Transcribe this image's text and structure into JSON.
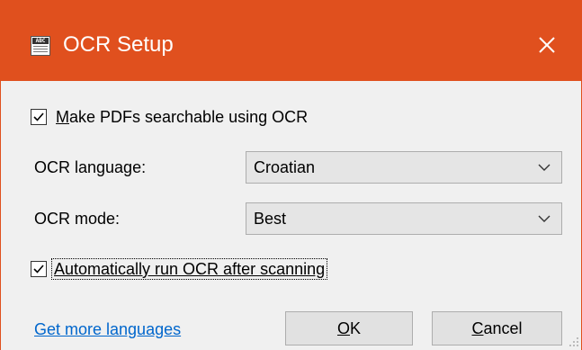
{
  "window": {
    "title": "OCR Setup",
    "icon": "ocr-abc-icon",
    "close_icon": "close-icon",
    "accent_color": "#e0501e"
  },
  "options": {
    "make_searchable": {
      "checked": true,
      "mnemonic": "M",
      "label_rest": "ake PDFs searchable using OCR"
    },
    "auto_run": {
      "checked": true,
      "label": "Automatically run OCR after scanning"
    }
  },
  "fields": {
    "language": {
      "label": "OCR language:",
      "value": "Croatian"
    },
    "mode": {
      "label": "OCR mode:",
      "value": "Best"
    }
  },
  "footer": {
    "link_text": "Get more languages",
    "ok_mnemonic": "O",
    "ok_rest": "K",
    "cancel_mnemonic": "C",
    "cancel_rest": "ancel"
  }
}
